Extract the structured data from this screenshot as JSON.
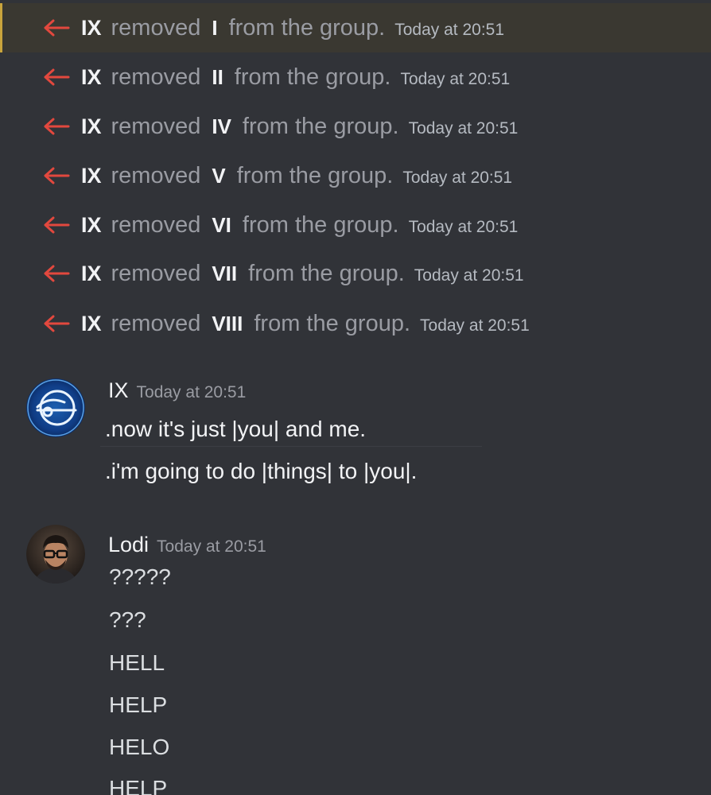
{
  "colors": {
    "background": "#313338",
    "highlight_row": "#3a3831",
    "highlight_bar": "#c9a43c",
    "arrow_red": "#e2483e",
    "text_primary": "#f2f3f5",
    "text_muted": "#9a9ca3"
  },
  "system_messages": [
    {
      "actor": "IX",
      "verb": "removed",
      "target": "I",
      "tail": "from the group.",
      "time": "Today at 20:51"
    },
    {
      "actor": "IX",
      "verb": "removed",
      "target": "II",
      "tail": "from the group.",
      "time": "Today at 20:51"
    },
    {
      "actor": "IX",
      "verb": "removed",
      "target": "IV",
      "tail": "from the group.",
      "time": "Today at 20:51"
    },
    {
      "actor": "IX",
      "verb": "removed",
      "target": "V",
      "tail": "from the group.",
      "time": "Today at 20:51"
    },
    {
      "actor": "IX",
      "verb": "removed",
      "target": "VI",
      "tail": "from the group.",
      "time": "Today at 20:51"
    },
    {
      "actor": "IX",
      "verb": "removed",
      "target": "VII",
      "tail": "from the group.",
      "time": "Today at 20:51"
    },
    {
      "actor": "IX",
      "verb": "removed",
      "target": "VIII",
      "tail": "from the group.",
      "time": "Today at 20:51"
    }
  ],
  "messages": [
    {
      "author": "IX",
      "time": "Today at 20:51",
      "avatar_icon": "blue-eye-emblem-icon",
      "lines": [
        ".now it's just |you| and me.",
        ".i'm going to do |things| to |you|."
      ]
    },
    {
      "author": "Lodi",
      "time": "Today at 20:51",
      "avatar_icon": "user-photo-avatar",
      "lines": [
        "?????",
        "???",
        "HELL",
        "HELP",
        "HELO",
        "HELP"
      ]
    }
  ]
}
